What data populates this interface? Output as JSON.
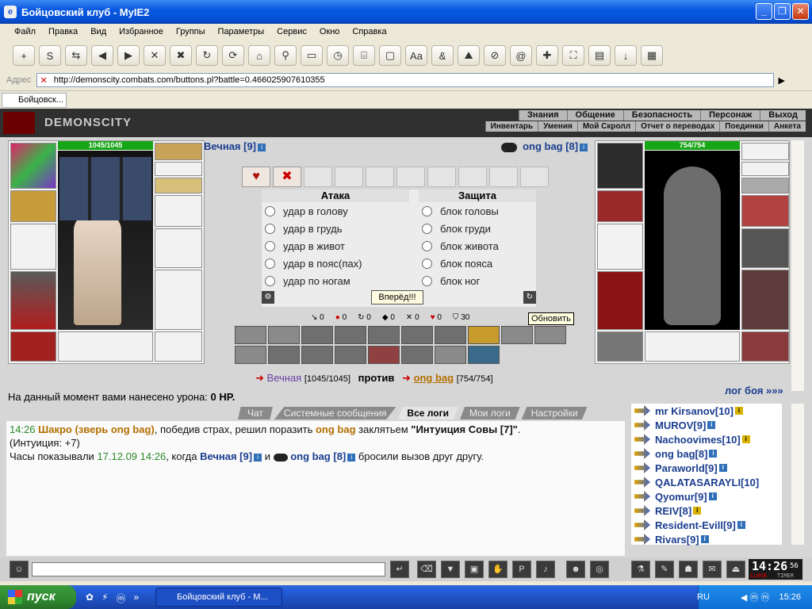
{
  "window": {
    "title": "Бойцовский клуб - MyIE2",
    "min": "_",
    "max": "❐",
    "close": "✕"
  },
  "menu": [
    "Файл",
    "Правка",
    "Вид",
    "Избранное",
    "Группы",
    "Параметры",
    "Сервис",
    "Окно",
    "Справка"
  ],
  "address": {
    "label": "Адрес",
    "url": "http://demonscity.combats.com/buttons.pl?battle=0.466025907610355"
  },
  "browser_tab": {
    "label": "Бойцовск..."
  },
  "game": {
    "logo": "DEMONSCITY",
    "nav_top": [
      "Знания",
      "Общение",
      "Безопасность",
      "Персонаж",
      "Выход"
    ],
    "nav_bottom": [
      "Инвентарь",
      "Умения",
      "Мой Скролл",
      "Отчет о переводах",
      "Поединки",
      "Анкета"
    ],
    "player": {
      "name": "Вечная [9]",
      "hp": "1045/1045",
      "hp_fraction": 1.0
    },
    "opponent": {
      "name": "ong bag [8]",
      "hp": "754/754",
      "hp_fraction": 1.0
    },
    "attack_header": "Атака",
    "defense_header": "Защита",
    "attacks": [
      "удар в голову",
      "удар в грудь",
      "удар в живот",
      "удар в пояс(пах)",
      "удар по ногам"
    ],
    "defenses": [
      "блок головы",
      "блок груди",
      "блок живота",
      "блок пояса",
      "блок ног"
    ],
    "forward_button": "Вперёд!!!",
    "refresh_tooltip": "Обновить",
    "stats": [
      "0",
      "0",
      "0",
      "0",
      "0",
      "0",
      "30"
    ],
    "versus": {
      "p1": "Вечная",
      "p1_hp": "[1045/1045]",
      "vs": "против",
      "p2": "ong bag",
      "p2_hp": "[754/754]"
    },
    "damage_label": "На данный момент вами нанесено урона:",
    "damage_value": "0 HP.",
    "battle_log_link": "лог боя »»»"
  },
  "chat": {
    "tabs": [
      "Чат",
      "Системные сообщения",
      "Все логи",
      "Мои логи",
      "Настройки"
    ],
    "active_tab": "Все логи",
    "line1": {
      "time": "14:26",
      "actor": "Шакро (зверь ong bag)",
      "t1": ", победив страх, решил поразить ",
      "target": "ong bag",
      "t2": " заклятьем ",
      "spell": "\"Интуиция Совы [7]\"",
      "t3": "."
    },
    "line2": "(Интуиция: +7)",
    "line3": {
      "t1": "Часы показывали ",
      "date": "17.12.09 14:26",
      "t2": ", когда ",
      "p1": "Вечная [9]",
      "and": " и ",
      "p2": "ong bag [8]",
      "t3": " бросили вызов друг другу."
    }
  },
  "users": [
    "mr Kirsanov[10]",
    "MUROV[9]",
    "Nachoovimes[10]",
    "ong bag[8]",
    "Paraworld[9]",
    "QALATASARAYLI[10]",
    "Qyomur[9]",
    "REIV[8]",
    "Resident-Evill[9]",
    "Rivars[9]"
  ],
  "clock": {
    "time": "14:26",
    "sec": "56",
    "clock_label": "CLOCK",
    "timer_label": "TIMER"
  },
  "taskbar": {
    "start": "пуск",
    "task": "Бойцовский клуб - M...",
    "lang": "RU",
    "time": "15:26"
  }
}
